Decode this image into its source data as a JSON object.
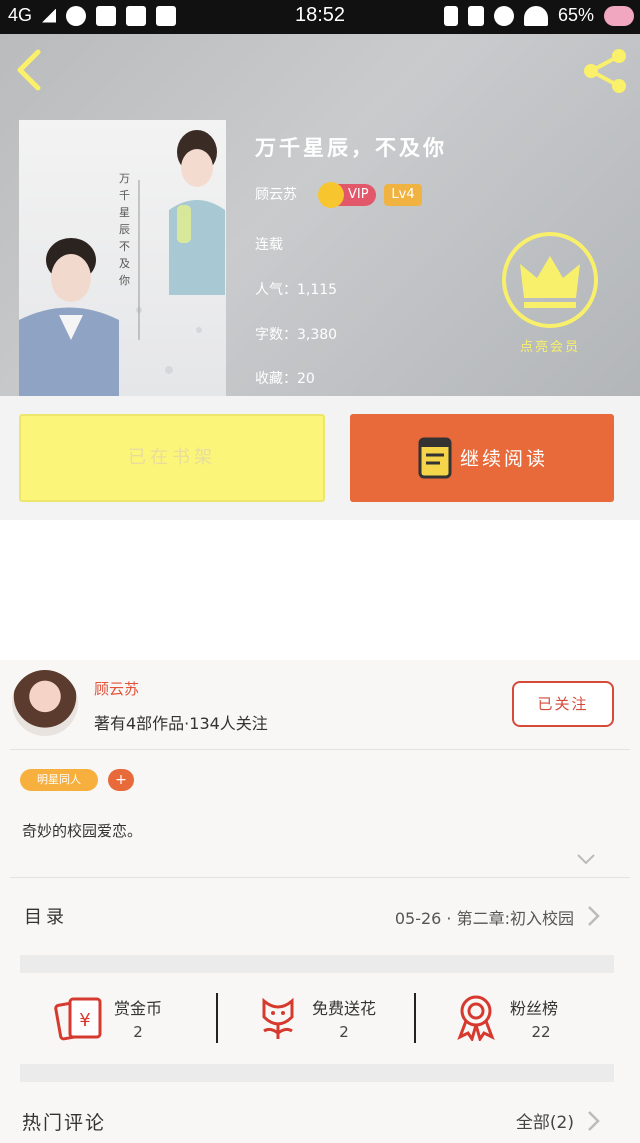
{
  "status_bar": {
    "network": "4G",
    "time": "18:52",
    "battery": "65%"
  },
  "book": {
    "title": "万千星辰，不及你",
    "cover_title": "万千星辰不及你",
    "author": "顾云苏",
    "vip_label": "VIP",
    "level": "Lv4",
    "status": "连载",
    "popularity": "人气：1,115",
    "word_count": "字数：3,380",
    "favorites": "收藏：20",
    "member_label": "点亮会员"
  },
  "actions": {
    "in_shelf_label": "已在书架",
    "continue_label": "继续阅读"
  },
  "author_card": {
    "name": "顾云苏",
    "meta": "著有4部作品·134人关注",
    "follow_label": "已关注"
  },
  "tags": {
    "tag": "明星同人",
    "add": "+"
  },
  "intro": "奇妙的校园爱恋。",
  "toc": {
    "label": "目录",
    "latest": "05-26 · 第二章:初入校园"
  },
  "stats": [
    {
      "name": "赏金币",
      "value": "2",
      "icon": "red-envelope-icon"
    },
    {
      "name": "免费送花",
      "value": "2",
      "icon": "flower-icon"
    },
    {
      "name": "粉丝榜",
      "value": "22",
      "icon": "medal-icon"
    }
  ],
  "comments": {
    "label": "热门评论",
    "all": "全部(2)"
  },
  "colors": {
    "accent_orange": "#e86a3a",
    "shelf_yellow": "#fbf57a",
    "author_red": "#e2533a",
    "member_yellow": "#f8f06a"
  }
}
